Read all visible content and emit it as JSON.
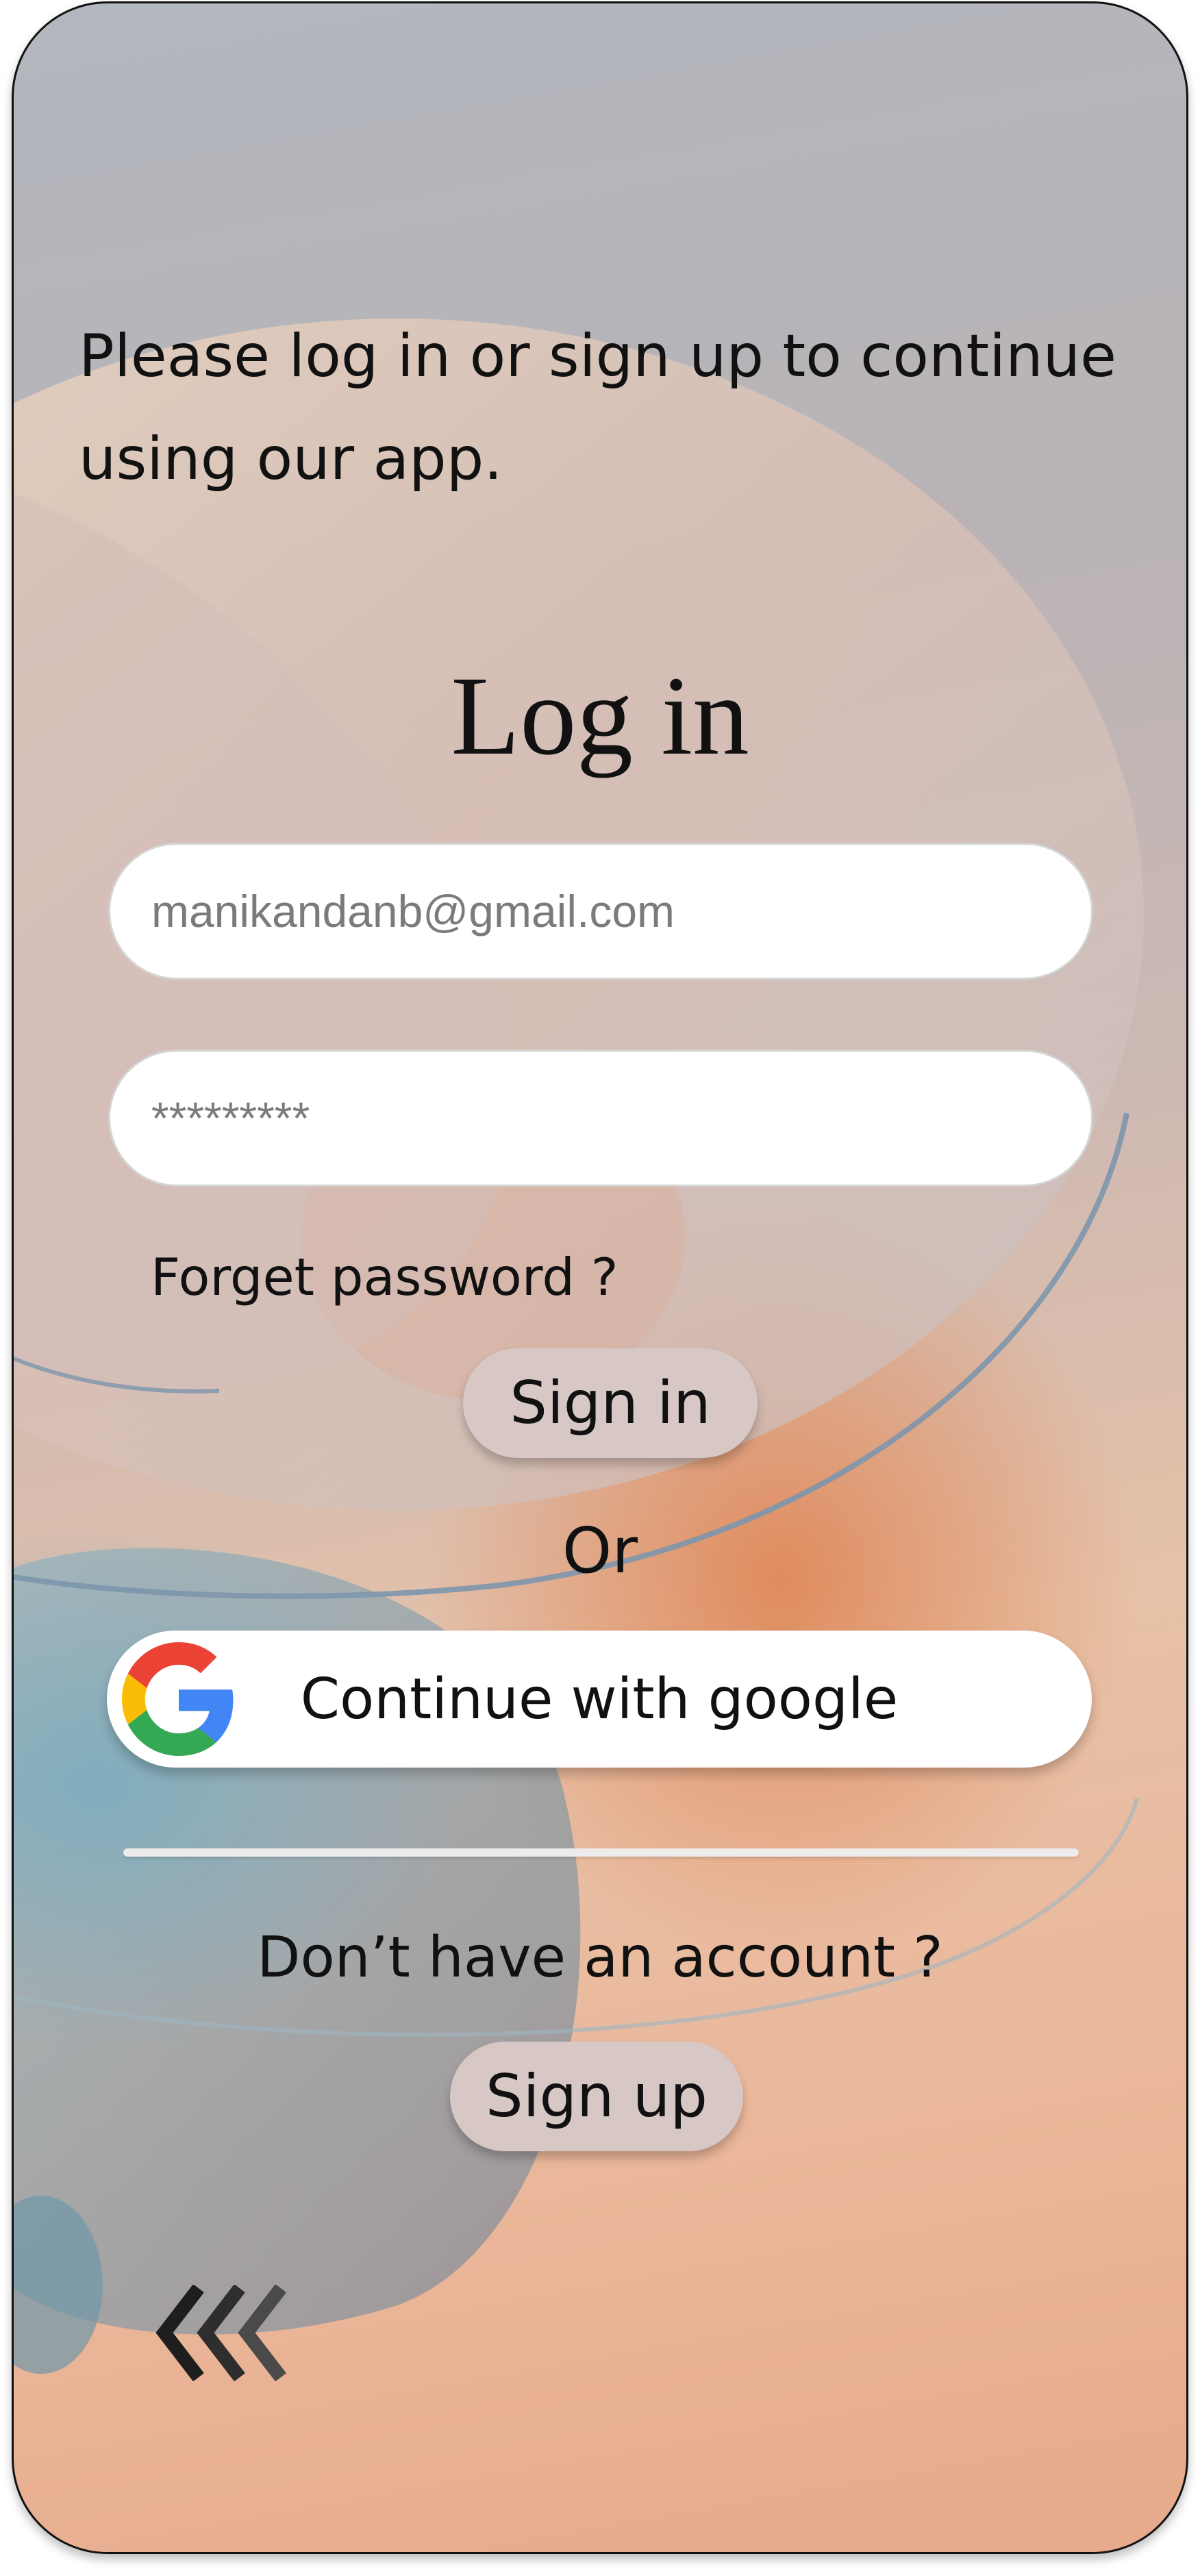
{
  "intro": {
    "line1": "Please log in or  sign up to continue",
    "line2": "using our app."
  },
  "login": {
    "title": "Log in",
    "email_value": "manikandanb@gmail.com",
    "password_value": "*********",
    "forget_password": "Forget password ?",
    "sign_in_label": "Sign in",
    "or_label": "Or",
    "google_label": "Continue with google"
  },
  "signup": {
    "prompt": "Don’t have an account ?",
    "sign_up_label": "Sign up"
  },
  "icons": {
    "google": "google-logo-icon",
    "back": "triple-chevron-left-icon"
  },
  "colors": {
    "pill_bg": "#d7c8c6",
    "field_bg": "#ffffff",
    "text": "#111111",
    "placeholder": "#7b7b7b"
  }
}
